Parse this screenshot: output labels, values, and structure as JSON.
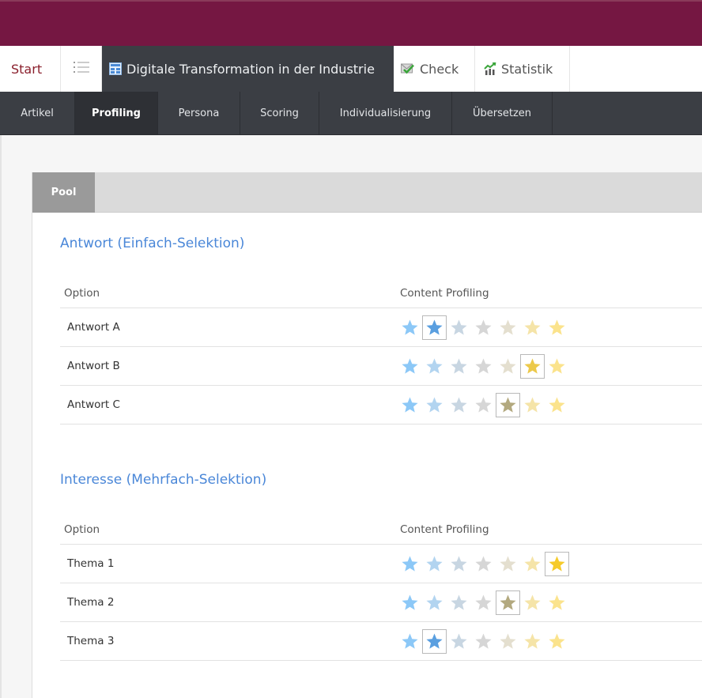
{
  "tabs": {
    "start": "Start",
    "list_icon": "list-icon",
    "document": {
      "icon": "document-icon",
      "label": "Digitale Transformation in der Industrie"
    },
    "check": {
      "icon": "check-icon",
      "label": "Check"
    },
    "statistik": {
      "icon": "statistics-icon",
      "label": "Statistik"
    }
  },
  "subnav": {
    "items": [
      {
        "label": "Artikel",
        "active": false
      },
      {
        "label": "Profiling",
        "active": true
      },
      {
        "label": "Persona",
        "active": false
      },
      {
        "label": "Scoring",
        "active": false
      },
      {
        "label": "Individualisierung",
        "active": false
      },
      {
        "label": "Übersetzen",
        "active": false
      }
    ]
  },
  "pool": {
    "tab_label": "Pool"
  },
  "star_colors": [
    "#8cc8f7",
    "#b2d4f0",
    "#c8d6e2",
    "#d6d6d6",
    "#e4dfcf",
    "#f5e4a8",
    "#fbe38c"
  ],
  "star_selected_colors": [
    "#8cc8f7",
    "#5a9fe0",
    "#c8d6e2",
    "#d6d6d6",
    "#b3a97f",
    "#ecc94a",
    "#f6cb2a"
  ],
  "sections": [
    {
      "title": "Antwort (Einfach-Selektion)",
      "col_option": "Option",
      "col_profiling": "Content Profiling",
      "rows": [
        {
          "label": "Antwort A",
          "selected_star": 2
        },
        {
          "label": "Antwort B",
          "selected_star": 6
        },
        {
          "label": "Antwort C",
          "selected_star": 5
        }
      ]
    },
    {
      "title": "Interesse (Mehrfach-Selektion)",
      "col_option": "Option",
      "col_profiling": "Content Profiling",
      "rows": [
        {
          "label": "Thema 1",
          "selected_star": 7
        },
        {
          "label": "Thema 2",
          "selected_star": 5
        },
        {
          "label": "Thema 3",
          "selected_star": 2
        }
      ]
    }
  ]
}
